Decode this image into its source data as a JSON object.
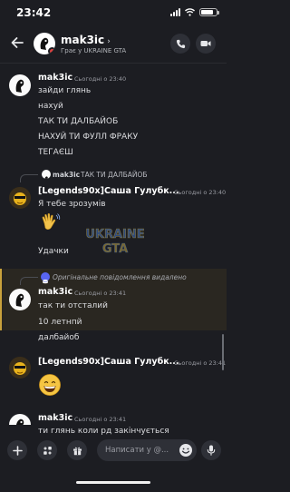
{
  "status": {
    "time": "23:42"
  },
  "header": {
    "name": "mak3ic",
    "subtitle": "Грає у UKRAINE GTA"
  },
  "messages": {
    "m1": {
      "author": "mak3ic",
      "time": "Сьогодні о 23:40",
      "lines": [
        "зайди глянь",
        "нахуй",
        "ТАК ТИ ДАЛБАЙОБ",
        "НАХУЙ ТИ ФУЛЛ ФРАКУ",
        "ТЕГАЄШ"
      ]
    },
    "m2": {
      "reply_author": "mak3ic",
      "reply_text": "ТАК ТИ ДАЛБАЙОБ",
      "author": "[Legends90x]Саша Гулубк...",
      "time": "Сьогодні о 23:40",
      "lines": [
        "Я тебе зрозумів"
      ],
      "after_emoji": "Удачки"
    },
    "m3": {
      "reference_text": "Оригінальне повідомлення видалено",
      "author": "mak3ic",
      "time": "Сьогодні о 23:41",
      "lines": [
        "так ти отсталий",
        "10 летнпй",
        "далбайоб"
      ]
    },
    "m4": {
      "author": "[Legends90x]Саша Гулубк...",
      "time": "Сьогодні о 23:41"
    },
    "m5": {
      "author": "mak3ic",
      "time": "Сьогодні о 23:41",
      "lines": [
        "ти глянь коли рд закінчується"
      ]
    }
  },
  "watermark": {
    "line1": "UKRAINE",
    "line2": "GTA"
  },
  "composer": {
    "placeholder": "Написати у @..."
  },
  "icons": {
    "back": "arrow-left-icon",
    "call": "phone-icon",
    "video": "video-icon",
    "add": "plus-icon",
    "apps": "apps-icon",
    "gift": "gift-icon",
    "emoji": "emoji-icon",
    "mic": "microphone-icon"
  },
  "colors": {
    "background": "#1c1d22",
    "highlight": "#c9a23c",
    "discord": "#5865f2",
    "status_red": "#e0413f"
  }
}
